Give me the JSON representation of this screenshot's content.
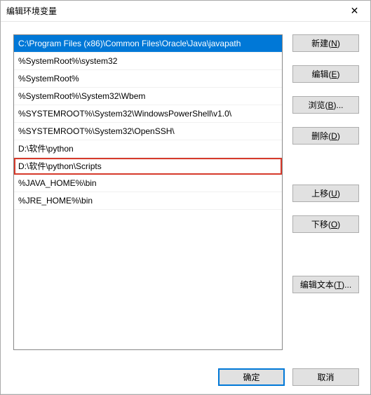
{
  "title": "编辑环境变量",
  "list_items": [
    {
      "text": "C:\\Program Files (x86)\\Common Files\\Oracle\\Java\\javapath",
      "selected": true,
      "highlighted": false
    },
    {
      "text": "%SystemRoot%\\system32",
      "selected": false,
      "highlighted": false
    },
    {
      "text": "%SystemRoot%",
      "selected": false,
      "highlighted": false
    },
    {
      "text": "%SystemRoot%\\System32\\Wbem",
      "selected": false,
      "highlighted": false
    },
    {
      "text": "%SYSTEMROOT%\\System32\\WindowsPowerShell\\v1.0\\",
      "selected": false,
      "highlighted": false
    },
    {
      "text": "%SYSTEMROOT%\\System32\\OpenSSH\\",
      "selected": false,
      "highlighted": false
    },
    {
      "text": "D:\\软件\\python",
      "selected": false,
      "highlighted": false
    },
    {
      "text": "D:\\软件\\python\\Scripts",
      "selected": false,
      "highlighted": true
    },
    {
      "text": "%JAVA_HOME%\\bin",
      "selected": false,
      "highlighted": false
    },
    {
      "text": "%JRE_HOME%\\bin",
      "selected": false,
      "highlighted": false
    }
  ],
  "buttons": {
    "new": {
      "label": "新建(",
      "mnemonic": "N",
      "suffix": ")"
    },
    "edit": {
      "label": "编辑(",
      "mnemonic": "E",
      "suffix": ")"
    },
    "browse": {
      "label": "浏览(",
      "mnemonic": "B",
      "suffix": ")..."
    },
    "delete": {
      "label": "删除(",
      "mnemonic": "D",
      "suffix": ")"
    },
    "moveup": {
      "label": "上移(",
      "mnemonic": "U",
      "suffix": ")"
    },
    "movedown": {
      "label": "下移(",
      "mnemonic": "O",
      "suffix": ")"
    },
    "edittext": {
      "label": "编辑文本(",
      "mnemonic": "T",
      "suffix": ")..."
    },
    "ok": "确定",
    "cancel": "取消"
  }
}
